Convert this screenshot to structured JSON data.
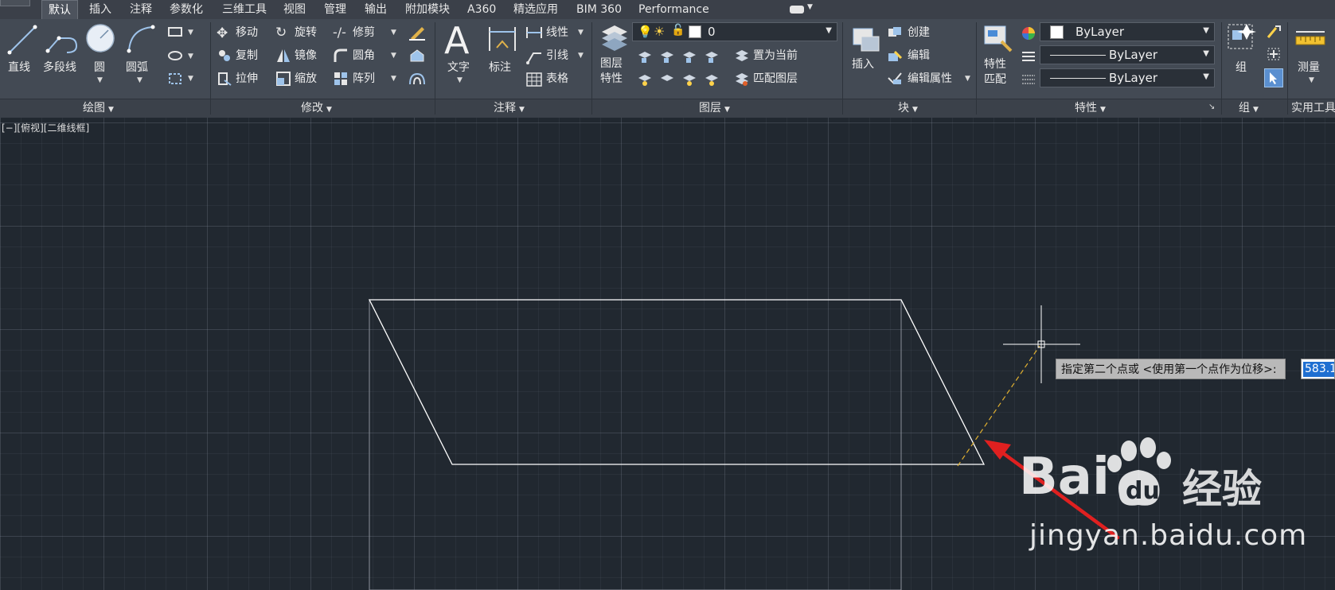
{
  "tabs": [
    "默认",
    "插入",
    "注释",
    "参数化",
    "三维工具",
    "视图",
    "管理",
    "输出",
    "附加模块",
    "A360",
    "精选应用",
    "BIM 360",
    "Performance"
  ],
  "draw_panel": {
    "title": "绘图",
    "line": "直线",
    "polyline": "多段线",
    "circle": "圆",
    "arc": "圆弧"
  },
  "modify_panel": {
    "title": "修改",
    "move": "移动",
    "rotate": "旋转",
    "trim": "修剪",
    "copy": "复制",
    "mirror": "镜像",
    "fillet": "圆角",
    "stretch": "拉伸",
    "scale": "缩放",
    "array": "阵列"
  },
  "annotation_panel": {
    "title": "注释",
    "text": "文字",
    "dimension": "标注",
    "linear": "线性",
    "leader": "引线",
    "table": "表格"
  },
  "layer_panel": {
    "title": "图层",
    "layer_props": [
      "图层",
      "特性"
    ],
    "layer_value": "0",
    "make_current": "置为当前",
    "match_layer": "匹配图层"
  },
  "block_panel": {
    "title": "块",
    "insert": "插入",
    "create": "创建",
    "edit": "编辑",
    "edit_attr": "编辑属性"
  },
  "properties_panel": {
    "title": "特性",
    "match": [
      "特性",
      "匹配"
    ],
    "color": "ByLayer",
    "linetype": "ByLayer",
    "lineweight": "ByLayer"
  },
  "group_panel": {
    "title": "组",
    "group": "组"
  },
  "utilities_panel": {
    "title": "实用工具",
    "measure": "测量"
  },
  "viewport": {
    "label": "[−][俯视][二维线框]",
    "prompt": "指定第二个点或 <使用第一个点作为位移>:",
    "input_value": "583.1"
  },
  "watermark": {
    "text": "经验",
    "url": "jingyan.baidu.com"
  },
  "colors": {
    "canvas": "#212830",
    "ribbon": "#434a54",
    "geometry": "#ffffff",
    "rubberband": "#e0b030",
    "arrow": "#e02020"
  }
}
